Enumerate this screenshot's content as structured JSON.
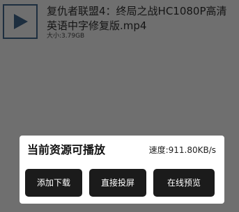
{
  "file": {
    "title": "复仇者联盟4：终局之战HC1080P高清英语中字修复版.mp4",
    "size_label": "大小:",
    "size_value": "3.79GB",
    "thumbnail_icon": "play-icon"
  },
  "dialog": {
    "title": "当前资源可播放",
    "speed_label": "速度:",
    "speed_value": "911.80KB/s",
    "buttons": {
      "download": "添加下载",
      "cast": "直接投屏",
      "preview": "在线预览"
    }
  },
  "colors": {
    "overlay": "#6f6f6f",
    "play_icon": "#1d2e3f",
    "button_bg": "#1b1b1b",
    "button_text": "#ffffff",
    "sheet_bg": "#ffffff"
  }
}
